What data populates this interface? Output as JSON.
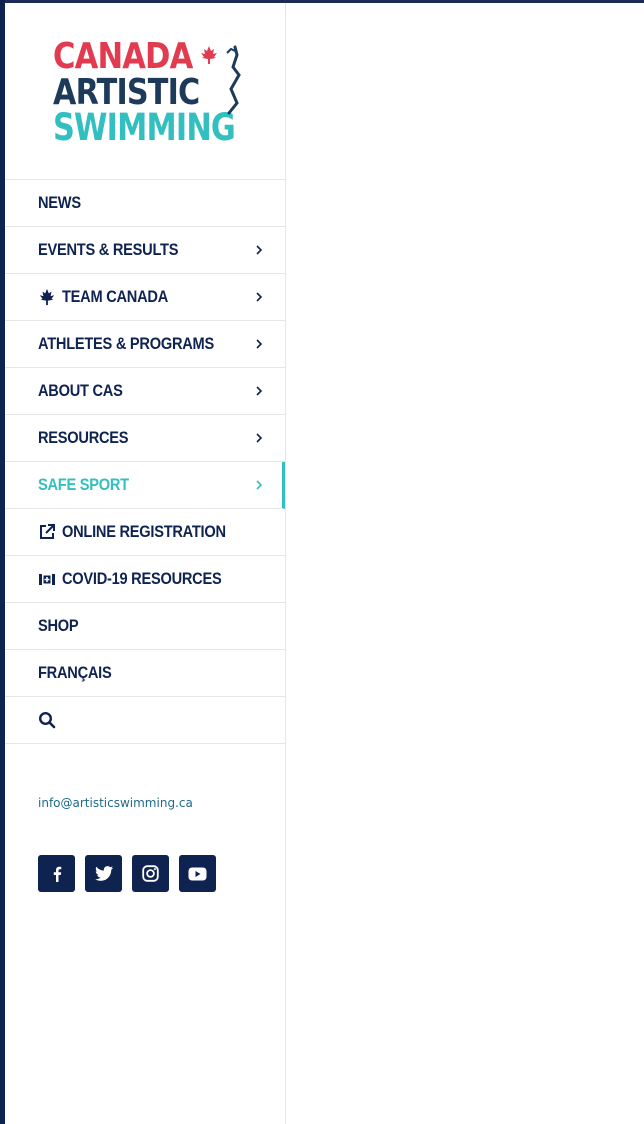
{
  "brand": {
    "logo_line1": "CANADA",
    "logo_line2": "ARTISTIC",
    "logo_line3": "SWIMMING",
    "colors": {
      "navy": "#0f2350",
      "teal": "#33bfc0",
      "red": "#e23a4f"
    }
  },
  "nav": {
    "items": [
      {
        "label": "NEWS",
        "has_chevron": false
      },
      {
        "label": "EVENTS & RESULTS",
        "has_chevron": true
      },
      {
        "label": "TEAM CANADA",
        "icon": "maple-leaf-icon",
        "has_chevron": true
      },
      {
        "label": "ATHLETES & PROGRAMS",
        "has_chevron": true
      },
      {
        "label": "ABOUT CAS",
        "has_chevron": true
      },
      {
        "label": "RESOURCES",
        "has_chevron": true
      },
      {
        "label": "SAFE SPORT",
        "has_chevron": true,
        "active": true
      },
      {
        "label": "ONLINE REGISTRATION",
        "icon": "external-link-icon",
        "has_chevron": false
      },
      {
        "label": "COVID-19 RESOURCES",
        "icon": "first-aid-kit-icon",
        "has_chevron": false
      },
      {
        "label": "SHOP",
        "has_chevron": false
      },
      {
        "label": "FRANÇAIS",
        "has_chevron": false
      }
    ],
    "search_icon": "search-icon"
  },
  "contact": {
    "email": "info@artisticswimming.ca"
  },
  "social": [
    {
      "name": "facebook-icon"
    },
    {
      "name": "twitter-icon"
    },
    {
      "name": "instagram-icon"
    },
    {
      "name": "youtube-icon"
    }
  ]
}
